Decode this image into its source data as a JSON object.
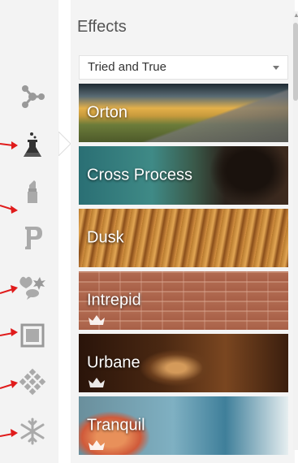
{
  "panel": {
    "title": "Effects",
    "dropdown": {
      "selected": "Tried and True"
    }
  },
  "toolbar": {
    "tools": [
      {
        "icon": "nodes-icon"
      },
      {
        "icon": "flask-icon",
        "selected": true
      },
      {
        "icon": "lipstick-icon"
      },
      {
        "icon": "p-icon"
      },
      {
        "icon": "sticker-icon"
      },
      {
        "icon": "frame-icon"
      },
      {
        "icon": "texture-icon"
      },
      {
        "icon": "snowflake-icon"
      }
    ]
  },
  "effects": [
    {
      "label": "Orton",
      "premium": false
    },
    {
      "label": "Cross Process",
      "premium": false
    },
    {
      "label": "Dusk",
      "premium": false
    },
    {
      "label": "Intrepid",
      "premium": true
    },
    {
      "label": "Urbane",
      "premium": true
    },
    {
      "label": "Tranquil",
      "premium": true
    }
  ],
  "colors": {
    "arrow": "#e01b1b",
    "toolbar_icon": "#9a9a9a",
    "selected_icon": "#3a3a3a"
  }
}
